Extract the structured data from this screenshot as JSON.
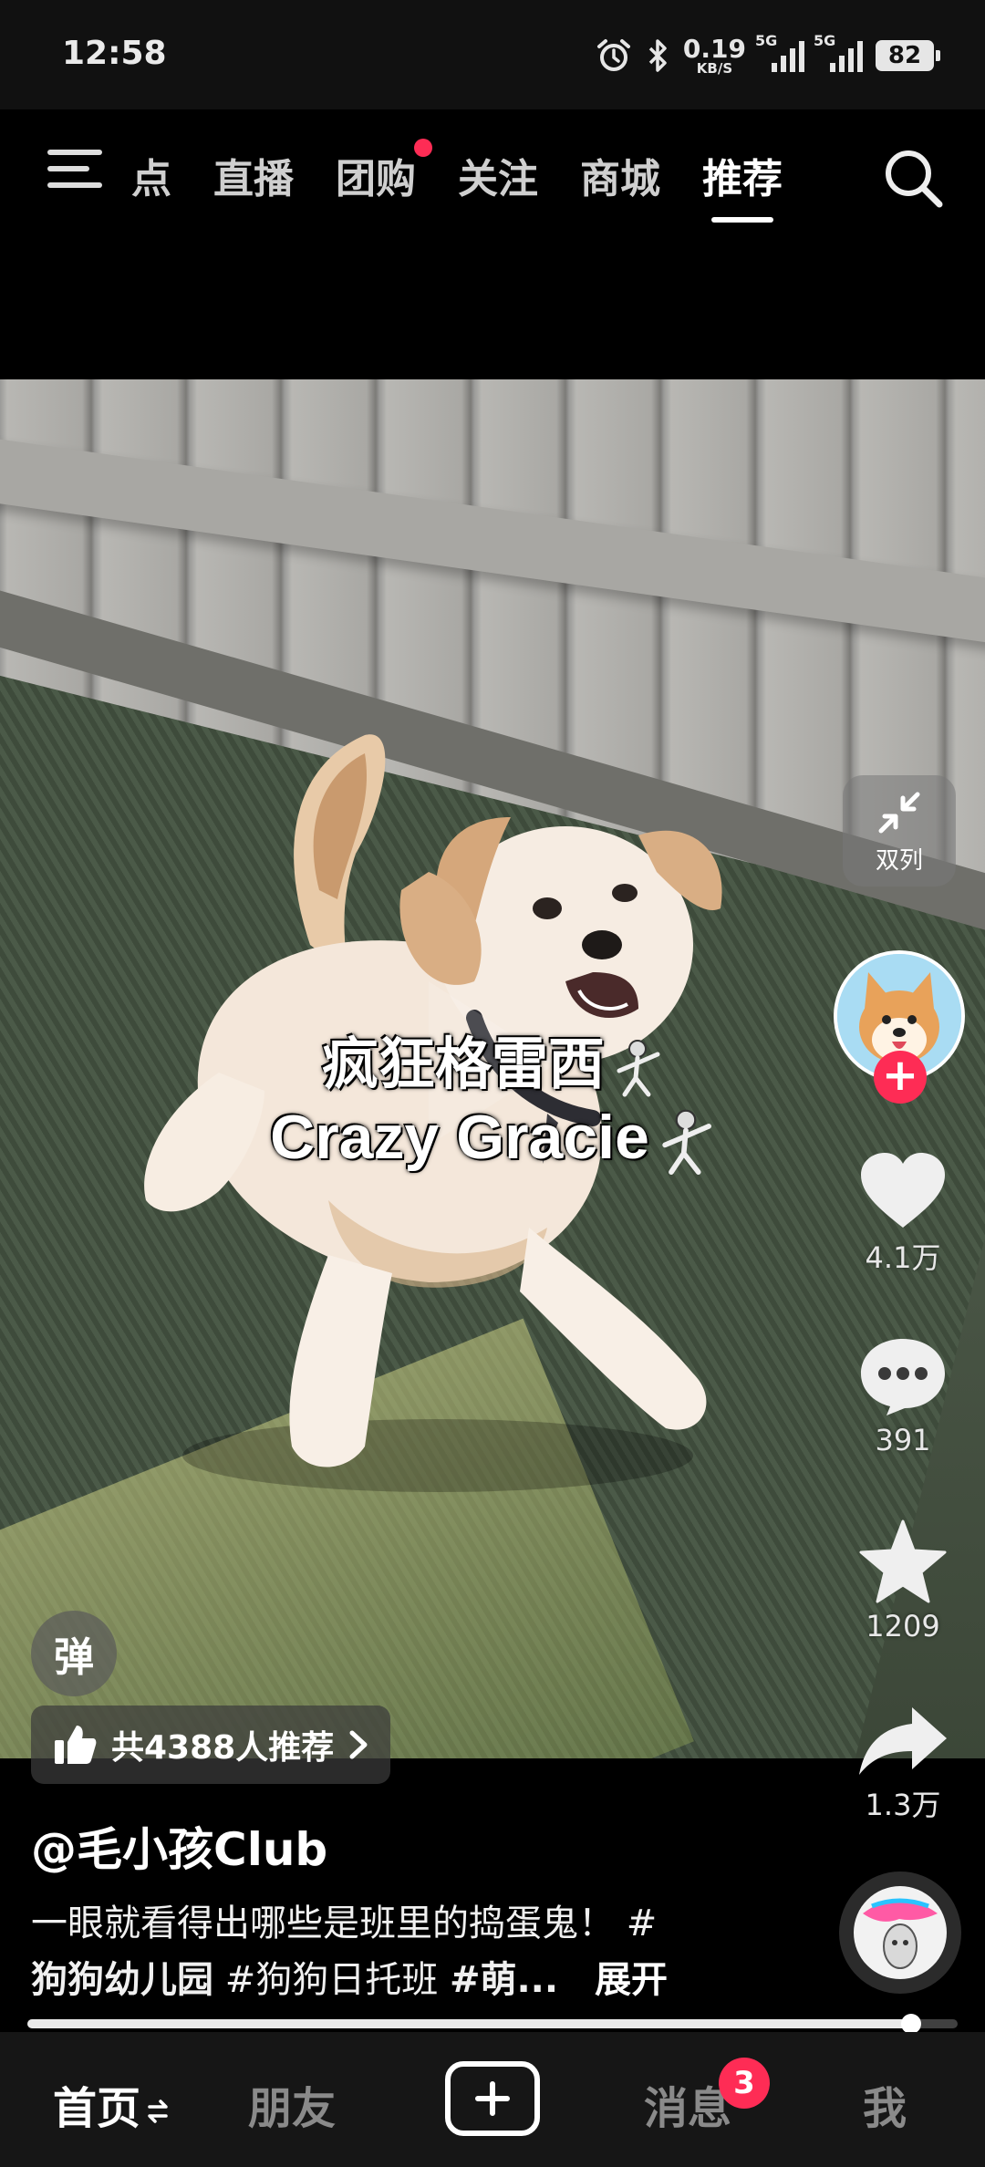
{
  "status_bar": {
    "time": "12:58",
    "net_speed": "0.19",
    "net_unit": "KB/S",
    "sim1_label": "5G",
    "sim2_label": "5G",
    "battery": "82"
  },
  "top_nav": {
    "tabs": [
      {
        "label": "热点",
        "visible_text": "点"
      },
      {
        "label": "直播"
      },
      {
        "label": "团购",
        "has_dot": true
      },
      {
        "label": "关注"
      },
      {
        "label": "商城"
      },
      {
        "label": "推荐",
        "active": true
      }
    ]
  },
  "video": {
    "switch_label": "双列",
    "caption_cn": "疯狂格雷西",
    "caption_en": "Crazy Gracie"
  },
  "actions": {
    "likes": "4.1万",
    "comments": "391",
    "favorites": "1209",
    "shares": "1.3万"
  },
  "overlay": {
    "danmu_label": "弹",
    "recommend_text": "共4388人推荐"
  },
  "post": {
    "author": "@毛小孩Club",
    "desc_line1": "一眼就看得出哪些是班里的捣蛋鬼！ #",
    "desc_tag1": "狗狗幼儿园",
    "desc_tag2": " #狗狗日托班 ",
    "desc_tag3": "#萌...",
    "expand_label": "展开",
    "progress": 0.95
  },
  "bottom_nav": {
    "home": "首页",
    "friends": "朋友",
    "messages": "消息",
    "messages_badge": "3",
    "me": "我"
  },
  "colors": {
    "accent": "#fe2c55",
    "background": "#000000"
  }
}
